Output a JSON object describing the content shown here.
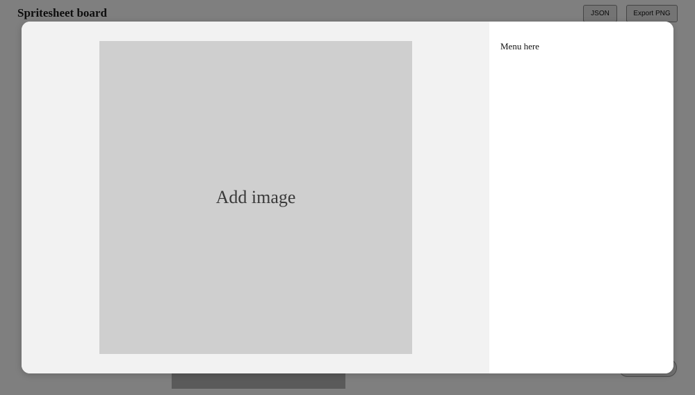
{
  "app": {
    "title": "Spritesheet board"
  },
  "toolbar": {
    "json_label": "JSON",
    "export_label": "Export PNG"
  },
  "modal": {
    "dropzone_label": "Add image",
    "menu_text": "Menu here"
  },
  "colors": {
    "overlay": "rgba(0,0,0,0.5)",
    "modal_left_bg": "#f2f2f2",
    "dropzone_bg": "#cfcfcf",
    "modal_right_bg": "#ffffff"
  }
}
